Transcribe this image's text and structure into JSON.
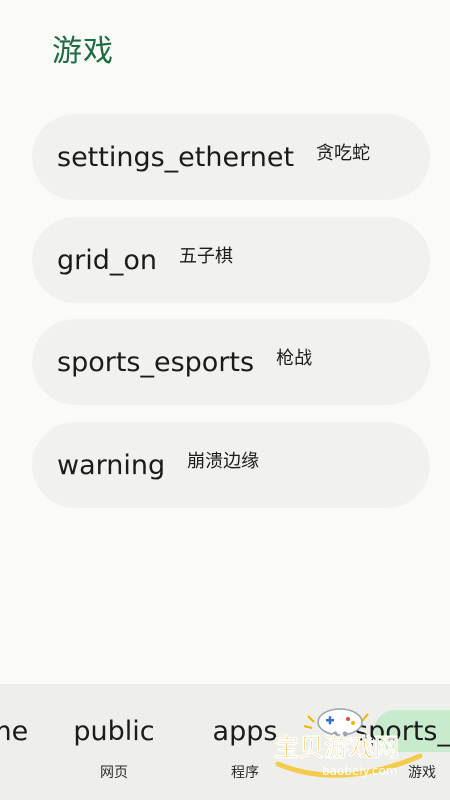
{
  "header": {
    "title": "游戏"
  },
  "games": [
    {
      "icon": "settings_ethernet",
      "label": "贪吃蛇"
    },
    {
      "icon": "grid_on",
      "label": "五子棋"
    },
    {
      "icon": "sports_esports",
      "label": "枪战"
    },
    {
      "icon": "warning",
      "label": "崩溃边缘"
    }
  ],
  "bottom_nav": {
    "items": [
      {
        "icon": "home",
        "label": ""
      },
      {
        "icon": "public",
        "label": "网页"
      },
      {
        "icon": "apps",
        "label": "程序"
      },
      {
        "icon": "sports_esports",
        "label": "游戏",
        "active": true
      }
    ]
  },
  "watermark": {
    "text": "宝贝游戏网",
    "url": "baobeiy.com"
  },
  "colors": {
    "accent": "#1d6b45",
    "card_bg": "#f1f1ee",
    "page_bg": "#fafbf7",
    "nav_bg": "#eeefeb",
    "active_pill": "#c9ebcd"
  }
}
